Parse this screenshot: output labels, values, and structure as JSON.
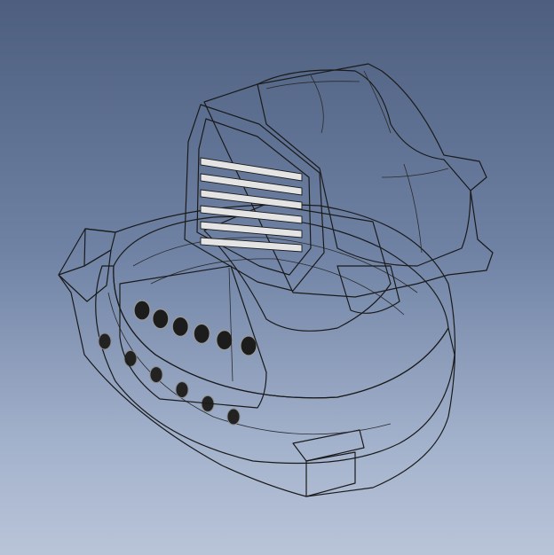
{
  "viewport": {
    "background_top": "#4d5e7e",
    "background_bottom": "#b9c4d8",
    "model_base_color": "#8e8e8e",
    "model_highlight_color": "#e6e6e6",
    "model_shadow_color": "#2b2b2b"
  },
  "model": {
    "icon": "cad-part-render",
    "holes_front_row": 6,
    "holes_lower_row": 6,
    "connector_ribs": 6
  }
}
